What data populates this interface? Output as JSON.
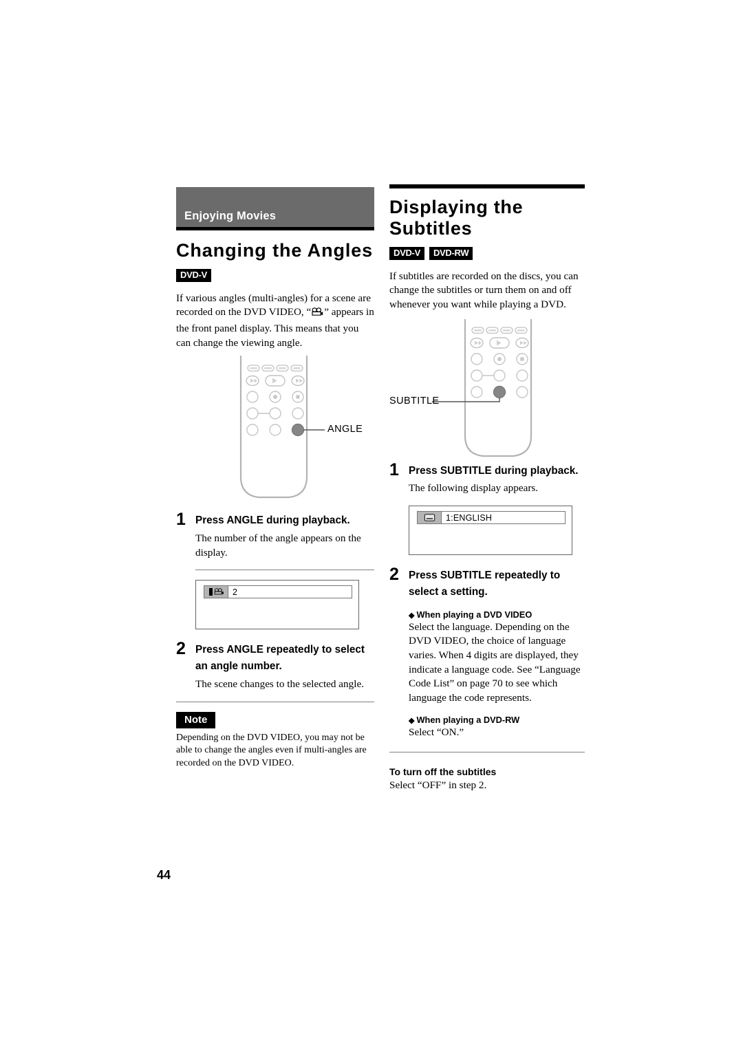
{
  "page": {
    "number": "44"
  },
  "left_column": {
    "banner": {
      "label": "Enjoying Movies"
    },
    "title": "Changing the Angles",
    "badges": [
      "DVD-V"
    ],
    "intro_part1": "If various angles (multi-angles) for a scene are recorded on the DVD VIDEO, “",
    "intro_part2": "” appears in the front panel display. This means that you can change the viewing angle.",
    "remote": {
      "callout_label": "ANGLE",
      "highlighted_button": "angle-button"
    },
    "steps": [
      {
        "num": "1",
        "head": "Press ANGLE during playback.",
        "sub": "The number of the angle appears on the display."
      },
      {
        "num": "2",
        "head_line1": "Press ANGLE repeatedly to select",
        "head_line2": "an angle number.",
        "sub": "The scene changes to the selected angle."
      }
    ],
    "osd": {
      "text": "2",
      "icon": "angle-camera-icon"
    },
    "note": {
      "tag": "Note",
      "body": "Depending on the DVD VIDEO, you may not be able to change the angles even if multi-angles are recorded on the DVD VIDEO."
    }
  },
  "right_column": {
    "title": "Displaying the Subtitles",
    "badges": [
      "DVD-V",
      "DVD-RW"
    ],
    "intro": "If subtitles are recorded on the discs, you can change the subtitles or turn them on and off whenever you want while playing a DVD.",
    "remote": {
      "callout_label": "SUBTITLE",
      "highlighted_button": "subtitle-button"
    },
    "steps": [
      {
        "num": "1",
        "head": "Press SUBTITLE during playback.",
        "sub": "The following display appears."
      },
      {
        "num": "2",
        "head_line1": "Press SUBTITLE repeatedly to",
        "head_line2": "select a setting."
      }
    ],
    "osd": {
      "text": "1:ENGLISH",
      "icon": "subtitle-screen-icon"
    },
    "dvd_video_section": {
      "heading": "When playing a DVD VIDEO",
      "body": "Select the language. Depending on the DVD VIDEO, the choice of language varies. When 4 digits are displayed, they indicate a language code. See “Language Code List” on page 70 to see which language the code represents."
    },
    "dvd_rw_section": {
      "heading": "When playing a DVD-RW",
      "body": "Select “ON.”"
    },
    "turn_off_section": {
      "heading": "To turn off the subtitles",
      "body": "Select “OFF” in step 2."
    }
  }
}
